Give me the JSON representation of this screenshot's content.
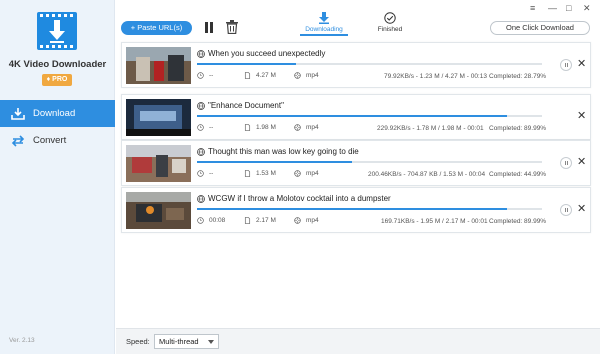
{
  "app": {
    "name": "4K Video Downloader",
    "badge": "PRO",
    "version": "Ver. 2.13"
  },
  "sidebar": {
    "items": [
      {
        "label": "Download",
        "icon": "download-tray-icon",
        "active": true
      },
      {
        "label": "Convert",
        "icon": "convert-arrows-icon",
        "active": false
      }
    ]
  },
  "toolbar": {
    "paste_label": "+ Paste URL(s)",
    "pause_icon": "pause-icon",
    "trash_icon": "trash-icon",
    "tabs": [
      {
        "label": "Downloading",
        "icon": "download-arrow-icon",
        "active": true
      },
      {
        "label": "Finished",
        "icon": "check-circle-icon",
        "active": false
      }
    ],
    "one_click_label": "One Click Download"
  },
  "window_controls": {
    "menu": "≡",
    "minimize": "—",
    "maximize": "□",
    "close": "✕"
  },
  "downloads": [
    {
      "title": "When you succeed unexpectedly",
      "duration": "--",
      "size": "4.27 M",
      "format": "mp4",
      "speed": "79.92KB/s - 1.23 M / 4.27 M - 00:13",
      "completed": "Completed: 28.79%",
      "progress": 0.2879
    },
    {
      "title": "\"Enhance Document\"",
      "duration": "--",
      "size": "1.98 M",
      "format": "mp4",
      "speed": "229.92KB/s - 1.78 M / 1.98 M - 00:01",
      "completed": "Completed: 89.99%",
      "progress": 0.8999
    },
    {
      "title": "Thought this man was low key going to die",
      "duration": "--",
      "size": "1.53 M",
      "format": "mp4",
      "speed": "200.46KB/s - 704.87 KB / 1.53 M - 00:04",
      "completed": "Completed: 44.99%",
      "progress": 0.4499
    },
    {
      "title": "WCGW if I throw a Molotov cocktail into a dumpster",
      "duration": "00:08",
      "size": "2.17 M",
      "format": "mp4",
      "speed": "169.71KB/s - 1.95 M / 2.17 M - 00:01",
      "completed": "Completed: 89.99%",
      "progress": 0.8999
    }
  ],
  "bottom": {
    "speed_label": "Speed:",
    "speed_value": "Multi-thread"
  },
  "colors": {
    "accent": "#2e8ee0",
    "sidebar_bg": "#ecf3fa",
    "badge": "#f0a840"
  }
}
